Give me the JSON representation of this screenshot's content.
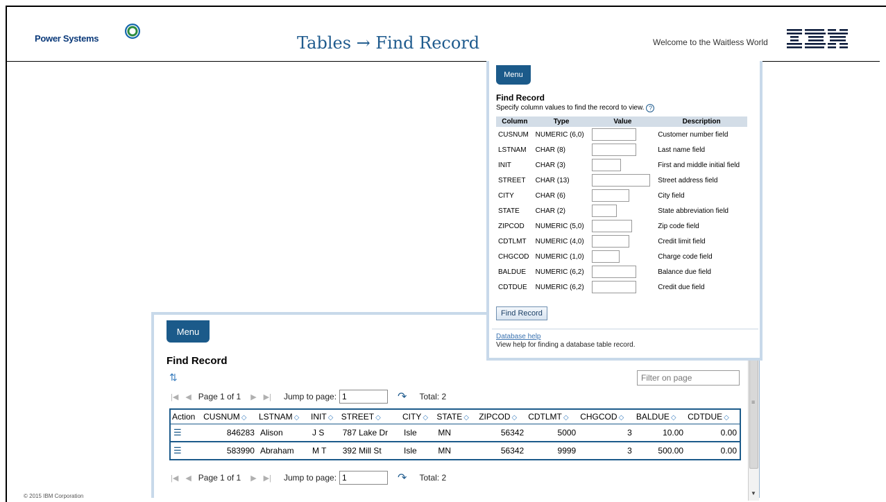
{
  "header": {
    "brand": "Power Systems",
    "title": "Tables → Find Record",
    "tagline": "Welcome to the Waitless World",
    "company_logo": "IBM"
  },
  "footer": {
    "copyright": "© 2015 IBM Corporation"
  },
  "form_panel": {
    "menu_label": "Menu",
    "title": "Find Record",
    "instructions": "Specify column values to find the record to view.",
    "columns": [
      "Column",
      "Type",
      "Value",
      "Description"
    ],
    "fields": [
      {
        "column": "CUSNUM",
        "type": "NUMERIC (6,0)",
        "value": "",
        "description": "Customer number field"
      },
      {
        "column": "LSTNAM",
        "type": "CHAR (8)",
        "value": "",
        "description": "Last name field"
      },
      {
        "column": "INIT",
        "type": "CHAR (3)",
        "value": "",
        "description": "First and middle initial field"
      },
      {
        "column": "STREET",
        "type": "CHAR (13)",
        "value": "",
        "description": "Street address field"
      },
      {
        "column": "CITY",
        "type": "CHAR (6)",
        "value": "",
        "description": "City field"
      },
      {
        "column": "STATE",
        "type": "CHAR (2)",
        "value": "",
        "description": "State abbreviation field"
      },
      {
        "column": "ZIPCOD",
        "type": "NUMERIC (5,0)",
        "value": "",
        "description": "Zip code field"
      },
      {
        "column": "CDTLMT",
        "type": "NUMERIC (4,0)",
        "value": "",
        "description": "Credit limit field"
      },
      {
        "column": "CHGCOD",
        "type": "NUMERIC (1,0)",
        "value": "",
        "description": "Charge code field"
      },
      {
        "column": "BALDUE",
        "type": "NUMERIC (6,2)",
        "value": "",
        "description": "Balance due field"
      },
      {
        "column": "CDTDUE",
        "type": "NUMERIC (6,2)",
        "value": "",
        "description": "Credit due field"
      }
    ],
    "button_label": "Find Record",
    "help_link": "Database help",
    "help_text": "View help for finding a database table record."
  },
  "list_panel": {
    "menu_label": "Menu",
    "title": "Find Record",
    "filter_placeholder": "Filter on page",
    "pager": {
      "page_text": "Page 1 of 1",
      "jump_label": "Jump to page:",
      "jump_value": "1",
      "total": "Total: 2"
    },
    "columns": [
      "Action",
      "CUSNUM",
      "LSTNAM",
      "INIT",
      "STREET",
      "CITY",
      "STATE",
      "ZIPCOD",
      "CDTLMT",
      "CHGCOD",
      "BALDUE",
      "CDTDUE"
    ],
    "rows": [
      {
        "cusnum": "846283",
        "lstnam": "Alison",
        "init": "J S",
        "street": "787 Lake Dr",
        "city": "Isle",
        "state": "MN",
        "zipcod": "56342",
        "cdtlmt": "5000",
        "chgcod": "3",
        "baldue": "10.00",
        "cdtdue": "0.00"
      },
      {
        "cusnum": "583990",
        "lstnam": "Abraham",
        "init": "M T",
        "street": "392 Mill St",
        "city": "Isle",
        "state": "MN",
        "zipcod": "56342",
        "cdtlmt": "9999",
        "chgcod": "3",
        "baldue": "500.00",
        "cdtdue": "0.00"
      }
    ]
  },
  "colors": {
    "accent": "#1b5a8a",
    "title": "#1f5b8e",
    "panel_border": "#c8d9ea"
  }
}
